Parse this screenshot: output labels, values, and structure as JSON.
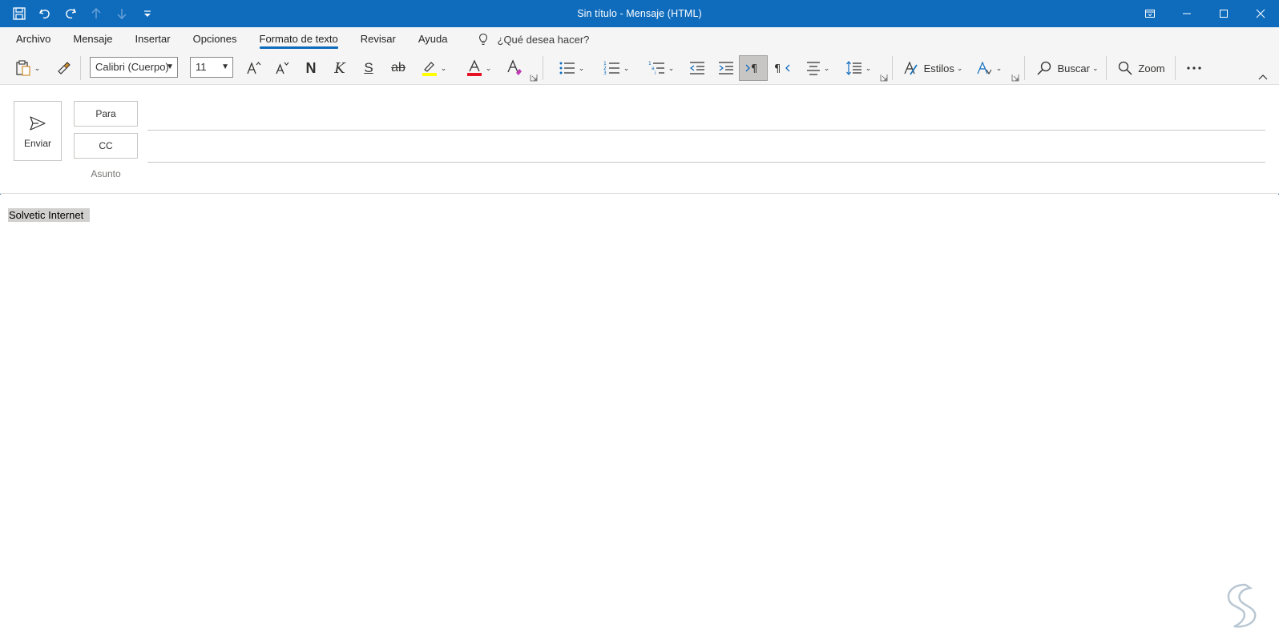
{
  "titlebar": {
    "title": "Sin título  -  Mensaje (HTML)"
  },
  "tabs": [
    {
      "label": "Archivo"
    },
    {
      "label": "Mensaje"
    },
    {
      "label": "Insertar"
    },
    {
      "label": "Opciones"
    },
    {
      "label": "Formato de texto",
      "active": true
    },
    {
      "label": "Revisar"
    },
    {
      "label": "Ayuda"
    }
  ],
  "tell_me": {
    "label": "¿Qué desea hacer?"
  },
  "ribbon": {
    "font_name": "Calibri (Cuerpo)",
    "font_size": "11",
    "bold": "N",
    "italic": "K",
    "underline": "S",
    "strike": "ab",
    "styles_label": "Estilos",
    "find_label": "Buscar",
    "zoom_label": "Zoom",
    "colors": {
      "highlight": "#ffff00",
      "font_color": "#e81123",
      "accent": "#0f6cbd"
    }
  },
  "compose": {
    "send_label": "Enviar",
    "to_label": "Para",
    "cc_label": "CC",
    "subject_label": "Asunto"
  },
  "body": {
    "text": "Solvetic Internet"
  }
}
